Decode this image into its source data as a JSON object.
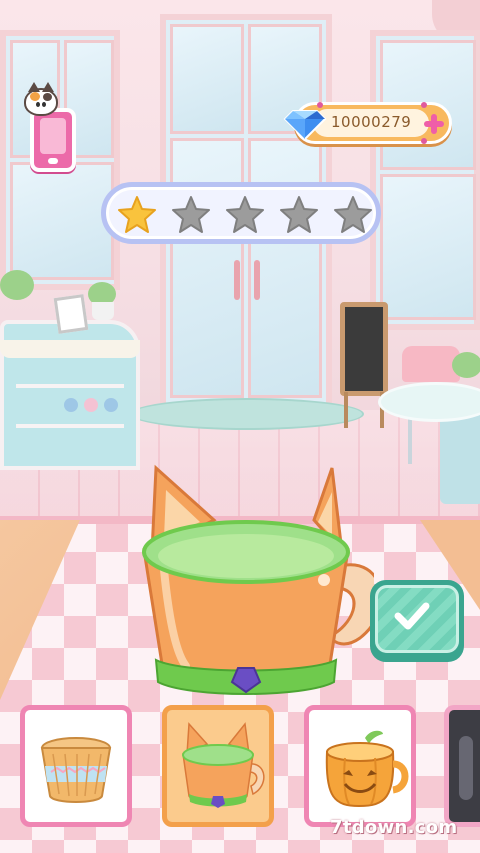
{
  "currency": {
    "icon": "blue-diamond-icon",
    "amount": "10000279",
    "add_icon": "plus-icon"
  },
  "rating": {
    "filled_stars": 1,
    "total_stars": 5,
    "filled_color": "#f9c33d",
    "empty_color": "#9c9c9c"
  },
  "phone_button": {
    "icon": "cat-phone-icon"
  },
  "confirm_button": {
    "icon": "checkmark-icon",
    "color": "#6fd0b6"
  },
  "bowl_options": [
    {
      "name": "wafer-cone-bowl",
      "icon": "wafer-cup-icon",
      "selected": false
    },
    {
      "name": "fox-ear-bowl",
      "icon": "fox-bowl-icon",
      "selected": true
    },
    {
      "name": "pumpkin-bowl",
      "icon": "pumpkin-cup-icon",
      "selected": false
    }
  ],
  "current_bowl": {
    "name": "fox-ear-bowl",
    "body_color": "#f5a35c",
    "rim_color": "#9fe08a",
    "band_color": "#6fca4d",
    "bow_color": "#6a4ec4"
  },
  "watermark": "7tdown.com"
}
